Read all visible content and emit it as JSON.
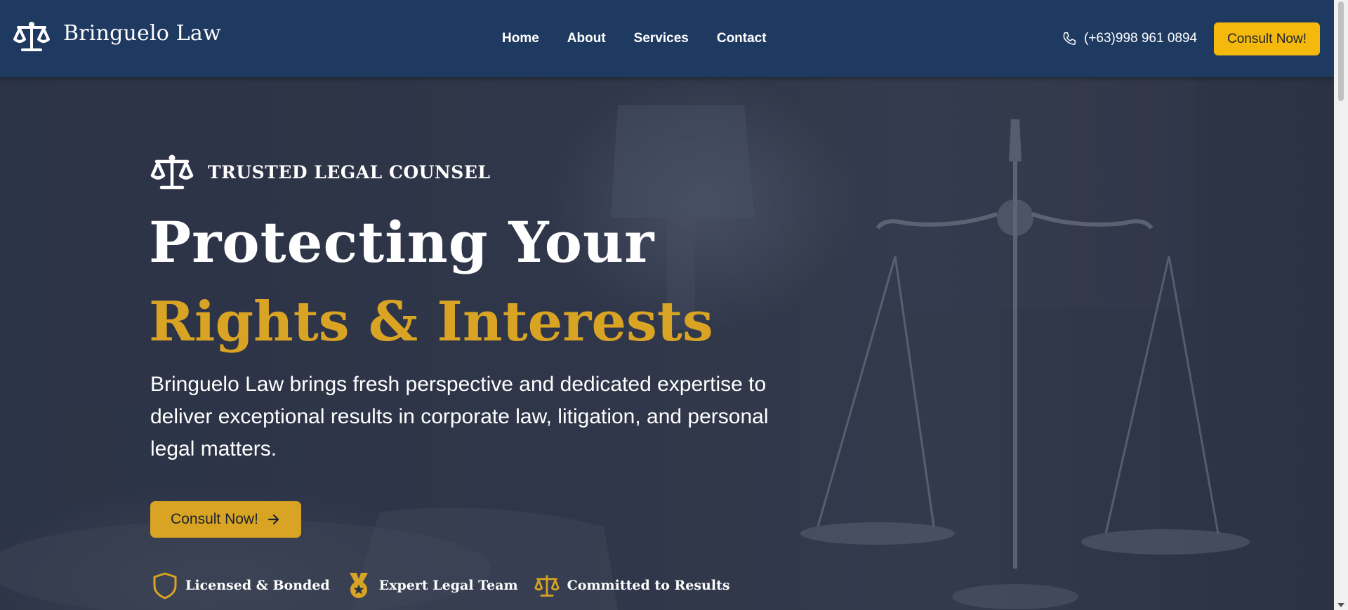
{
  "brand": {
    "name": "Bringuelo Law",
    "icon": "scales-of-justice-icon"
  },
  "nav": {
    "items": [
      "Home",
      "About",
      "Services",
      "Contact"
    ]
  },
  "contact": {
    "phone": "(+63)998 961 0894",
    "phone_icon": "phone-icon",
    "cta_label": "Consult Now!"
  },
  "hero": {
    "kicker": "TRUSTED LEGAL COUNSEL",
    "kicker_icon": "scales-of-justice-icon",
    "title_line1": "Protecting Your",
    "title_line2": "Rights & Interests",
    "description": "Bringuelo Law brings fresh perspective and dedicated expertise to deliver exceptional results in corporate law, litigation, and personal legal matters.",
    "cta_label": "Consult Now!",
    "cta_icon": "arrow-right-icon"
  },
  "badges": [
    {
      "label": "Licensed & Bonded",
      "icon": "shield-icon"
    },
    {
      "label": "Expert Legal Team",
      "icon": "medal-icon"
    },
    {
      "label": "Committed to Results",
      "icon": "scales-icon"
    }
  ],
  "colors": {
    "header_bg": "#1f3a61",
    "accent_gold": "#d9a423",
    "button_yellow": "#f5b90e",
    "hero_bg": "#2b3346"
  }
}
